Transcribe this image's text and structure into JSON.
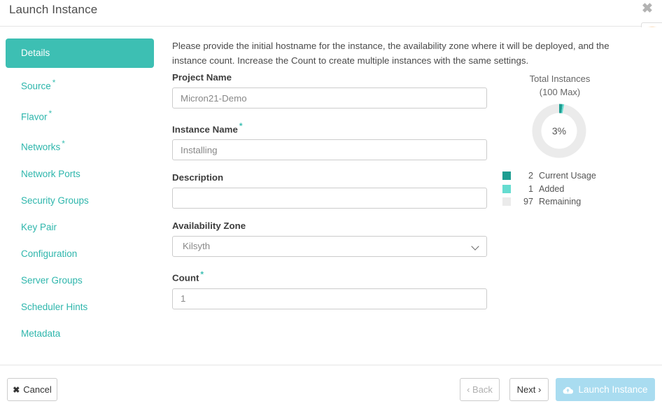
{
  "header": {
    "title": "Launch Instance",
    "close_label": "✖"
  },
  "help": {
    "glyph": "?"
  },
  "sidebar": {
    "items": [
      {
        "label": "Details",
        "required": false,
        "active": true
      },
      {
        "label": "Source",
        "required": true,
        "active": false
      },
      {
        "label": "Flavor",
        "required": true,
        "active": false
      },
      {
        "label": "Networks",
        "required": true,
        "active": false
      },
      {
        "label": "Network Ports",
        "required": false,
        "active": false
      },
      {
        "label": "Security Groups",
        "required": false,
        "active": false
      },
      {
        "label": "Key Pair",
        "required": false,
        "active": false
      },
      {
        "label": "Configuration",
        "required": false,
        "active": false
      },
      {
        "label": "Server Groups",
        "required": false,
        "active": false
      },
      {
        "label": "Scheduler Hints",
        "required": false,
        "active": false
      },
      {
        "label": "Metadata",
        "required": false,
        "active": false
      }
    ]
  },
  "main": {
    "intro": "Please provide the initial hostname for the instance, the availability zone where it will be deployed, and the instance count. Increase the Count to create multiple instances with the same settings.",
    "fields": {
      "project_name": {
        "label": "Project Name",
        "value": "Micron21-Demo",
        "required": false
      },
      "instance_name": {
        "label": "Instance Name",
        "value": "Installing",
        "required": true
      },
      "description": {
        "label": "Description",
        "value": "",
        "required": false
      },
      "availability_zone": {
        "label": "Availability Zone",
        "value": "Kilsyth",
        "required": false
      },
      "count": {
        "label": "Count",
        "value": "1",
        "required": true
      }
    },
    "required_marker": "*"
  },
  "quota": {
    "title": "Total Instances",
    "subtitle": "(100 Max)",
    "percent_label": "3%",
    "legend": [
      {
        "value": "2",
        "label": "Current Usage",
        "color": "#1c9d91"
      },
      {
        "value": "1",
        "label": "Added",
        "color": "#65dcd0"
      },
      {
        "value": "97",
        "label": "Remaining",
        "color": "#ebebeb"
      }
    ]
  },
  "chart_data": {
    "type": "pie",
    "title": "Total Instances (100 Max)",
    "categories": [
      "Current Usage",
      "Added",
      "Remaining"
    ],
    "values": [
      2,
      1,
      97
    ],
    "colors": [
      "#1c9d91",
      "#65dcd0",
      "#ebebeb"
    ],
    "max": 100,
    "percent_used": 3,
    "center_label": "3%",
    "legend_position": "below",
    "donut": true
  },
  "footer": {
    "cancel": {
      "label": "Cancel",
      "icon": "✖"
    },
    "back": {
      "label": "‹ Back",
      "disabled": true
    },
    "next": {
      "label": "Next ›",
      "disabled": false
    },
    "launch": {
      "label": "Launch Instance",
      "disabled": true
    }
  },
  "colors": {
    "accent_teal": "#3dbfb3",
    "accent_teal_dark": "#1c9d91",
    "accent_teal_light": "#65dcd0",
    "neutral_gray": "#ebebeb",
    "launch_blue": "#a9dcf0"
  }
}
